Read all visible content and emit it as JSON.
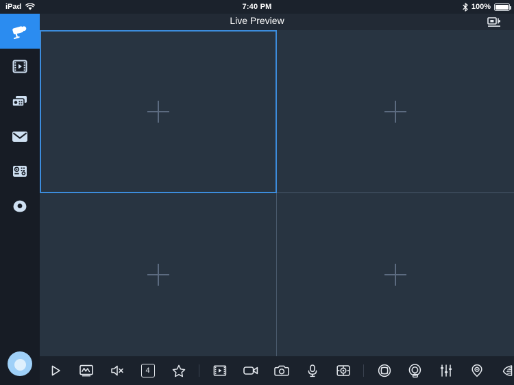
{
  "status_bar": {
    "device_label": "iPad",
    "wifi_icon": "wifi-icon",
    "time": "7:40 PM",
    "bluetooth_icon": "bluetooth-icon",
    "battery_percent": "100%",
    "battery_icon": "battery-full-icon"
  },
  "title_bar": {
    "title": "Live Preview",
    "action_icon": "camera-output-icon"
  },
  "sidebar": {
    "items": [
      {
        "name": "sidebar-item-live-preview",
        "icon": "security-camera-icon",
        "active": true
      },
      {
        "name": "sidebar-item-playback",
        "icon": "film-strip-icon",
        "active": false
      },
      {
        "name": "sidebar-item-devices",
        "icon": "device-cards-icon",
        "active": false
      },
      {
        "name": "sidebar-item-messages",
        "icon": "envelope-icon",
        "active": false
      },
      {
        "name": "sidebar-item-control-panel",
        "icon": "control-panel-icon",
        "active": false
      },
      {
        "name": "sidebar-item-disc",
        "icon": "disc-icon",
        "active": false
      }
    ],
    "profile_icon": "user-avatar-icon"
  },
  "grid": {
    "layout": "2x2",
    "cells": [
      {
        "name": "video-cell-1",
        "placeholder_icon": "plus-icon",
        "selected": true
      },
      {
        "name": "video-cell-2",
        "placeholder_icon": "plus-icon",
        "selected": false
      },
      {
        "name": "video-cell-3",
        "placeholder_icon": "plus-icon",
        "selected": false
      },
      {
        "name": "video-cell-4",
        "placeholder_icon": "plus-icon",
        "selected": false
      }
    ]
  },
  "toolbar": {
    "groups": [
      {
        "buttons": [
          {
            "name": "play-button",
            "icon": "play-icon"
          },
          {
            "name": "display-waveform-button",
            "icon": "monitor-waveform-icon"
          },
          {
            "name": "mute-button",
            "icon": "speaker-mute-icon"
          },
          {
            "name": "layout-button",
            "icon": "layout-grid-icon",
            "label": "4"
          },
          {
            "name": "favorite-button",
            "icon": "star-icon"
          }
        ]
      },
      {
        "buttons": [
          {
            "name": "clip-button",
            "icon": "film-clip-icon"
          },
          {
            "name": "record-button",
            "icon": "video-camera-icon"
          },
          {
            "name": "snapshot-button",
            "icon": "photo-camera-icon"
          },
          {
            "name": "microphone-button",
            "icon": "microphone-icon"
          },
          {
            "name": "ptz-button",
            "icon": "ptz-target-icon"
          }
        ]
      },
      {
        "buttons": [
          {
            "name": "fisheye-button",
            "icon": "fisheye-icon"
          },
          {
            "name": "panorama-button",
            "icon": "panorama-360-icon"
          },
          {
            "name": "image-settings-button",
            "icon": "sliders-icon"
          },
          {
            "name": "location-button",
            "icon": "location-pin-icon"
          },
          {
            "name": "fan-view-button",
            "icon": "fan-cone-icon"
          }
        ]
      }
    ],
    "more_icon": "chevron-right-icon"
  },
  "colors": {
    "accent": "#2b8cf0",
    "selection_border": "#3c8cdc",
    "sidebar_bg": "#171c25",
    "cell_bg": "#283441",
    "toolbar_bg": "#1b222c",
    "icon": "#e6eaef",
    "placeholder": "#5c6b80"
  }
}
